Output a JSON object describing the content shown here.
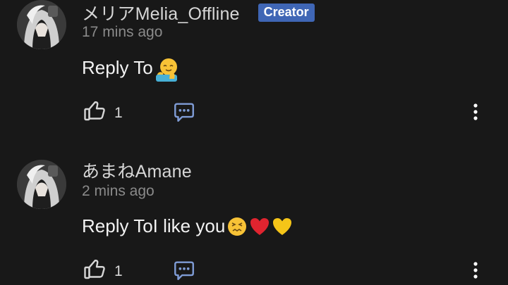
{
  "comments": [
    {
      "username": "メリアMelia_Offline",
      "badge": "Creator",
      "timestamp": "17 mins ago",
      "text": "Reply To",
      "emojis": [
        "hugging-face-emoji"
      ],
      "like_count": "1"
    },
    {
      "username": "あまねAmane",
      "timestamp": "2 mins ago",
      "text": "Reply ToI like you",
      "emojis": [
        "confounded-face-emoji",
        "red-heart-emoji",
        "yellow-heart-emoji"
      ],
      "like_count": "1"
    }
  ],
  "icons": {
    "like": "thumbs-up-icon",
    "reply": "chat-bubble-icon",
    "more": "vertical-ellipsis-icon"
  },
  "colors": {
    "background": "#181818",
    "badge": "#3f66b5",
    "icon": "#d6d6d6",
    "reply_icon": "#7f9cd6",
    "timestamp": "#8a8a8a"
  }
}
